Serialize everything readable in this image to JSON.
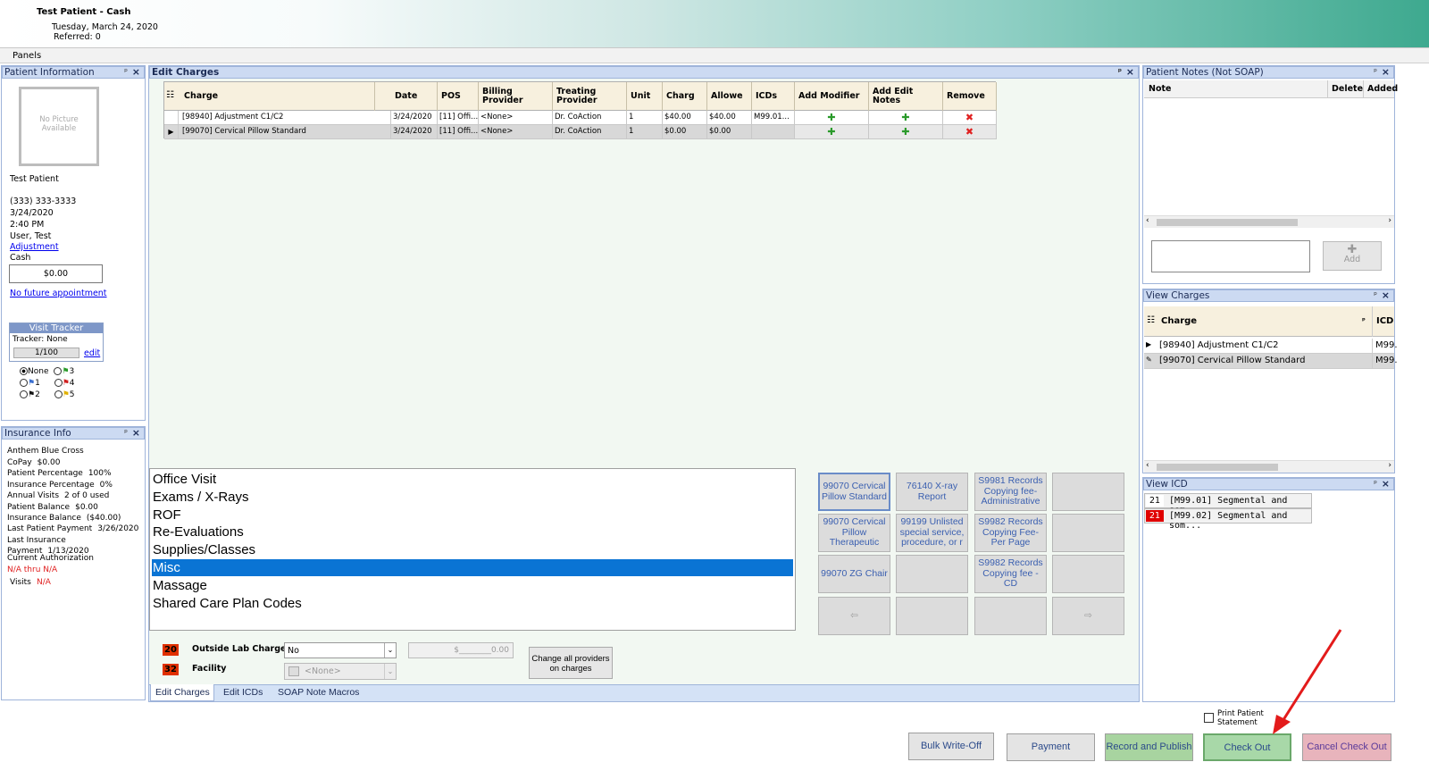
{
  "header": {
    "patient_title": "Test Patient - Cash",
    "date": "Tuesday, March 24, 2020",
    "referred": "Referred: 0"
  },
  "panels_label": "Panels",
  "patient_info": {
    "title": "Patient Information",
    "no_picture": "No Picture Available",
    "name": "Test Patient",
    "phone": "(333) 333-3333",
    "date": "3/24/2020",
    "time": "2:40 PM",
    "user": "User, Test",
    "adjustment_link": "Adjustment",
    "payer": "Cash",
    "balance": "$0.00",
    "future_appt": "No future appointment",
    "visit_tracker": {
      "title": "Visit Tracker",
      "tracker": "Tracker: None",
      "count": "1/100",
      "edit": "edit"
    },
    "flags": [
      "None",
      "1",
      "2",
      "3",
      "4",
      "5"
    ]
  },
  "insurance": {
    "title": "Insurance Info",
    "carrier": "Anthem Blue Cross",
    "rows": [
      {
        "k": "CoPay",
        "v": "$0.00"
      },
      {
        "k": "Patient Percentage",
        "v": "100%"
      },
      {
        "k": "Insurance Percentage",
        "v": "0%"
      },
      {
        "k": "Annual Visits",
        "v": "2 of 0 used"
      },
      {
        "k": "Patient Balance",
        "v": "$0.00"
      },
      {
        "k": "Insurance Balance",
        "v": "($40.00)"
      },
      {
        "k": "Last Patient Payment",
        "v": "3/26/2020"
      },
      {
        "k": "Last Insurance Payment",
        "v": "1/13/2020"
      }
    ],
    "current_auth": "Current Authorization",
    "auth_range": "N/A thru N/A",
    "visits_label": "Visits",
    "visits_value": "N/A"
  },
  "edit_charges": {
    "title": "Edit Charges",
    "columns": [
      "Charge",
      "Date",
      "POS",
      "Billing Provider",
      "Treating Provider",
      "Unit",
      "Charg",
      "Allowe",
      "ICDs",
      "Add Modifier",
      "Add Edit Notes",
      "Remove"
    ],
    "rows": [
      {
        "charge": "[98940] Adjustment C1/C2",
        "date": "3/24/2020",
        "pos": "[11] Offi...",
        "billing": "<None>",
        "treating": "Dr. CoAction",
        "unit": "1",
        "charg": "$40.00",
        "allowed": "$40.00",
        "icds": "M99.01..."
      },
      {
        "charge": "[99070] Cervical Pillow Standard",
        "date": "3/24/2020",
        "pos": "[11] Offi...",
        "billing": "<None>",
        "treating": "Dr. CoAction",
        "unit": "1",
        "charg": "$0.00",
        "allowed": "$0.00",
        "icds": ""
      }
    ],
    "categories": [
      "Office Visit",
      "Exams / X-Rays",
      "ROF",
      "Re-Evaluations",
      "Supplies/Classes",
      "Misc",
      "Massage",
      "Shared Care Plan Codes"
    ],
    "selected_category": "Misc",
    "quick_buttons": [
      "99070 Cervical Pillow Standard",
      "76140 X-ray Report",
      "S9981 Records Copying fee-Administrative",
      "",
      "99070 Cervical Pillow Therapeutic",
      "99199 Unlisted special service, procedure, or r",
      "S9982 Records Copying Fee-Per Page",
      "",
      "99070 ZG Chair",
      "",
      "S9982 Records Copying fee - CD",
      ""
    ],
    "outside_lab": {
      "badge": "20",
      "label": "Outside Lab Charges",
      "value": "No",
      "amount": "$________0.00"
    },
    "facility": {
      "badge": "32",
      "label": "Facility",
      "value": "<None>"
    },
    "change_providers": "Change all providers on charges",
    "tabs": [
      "Edit Charges",
      "Edit ICDs",
      "SOAP Note Macros"
    ]
  },
  "patient_notes": {
    "title": "Patient Notes (Not SOAP)",
    "columns": [
      "Note",
      "Delete",
      "Added"
    ],
    "add": "Add"
  },
  "view_charges": {
    "title": "View Charges",
    "columns": [
      "Charge",
      "ICD"
    ],
    "rows": [
      {
        "charge": "[98940] Adjustment C1/C2",
        "icd": "M99."
      },
      {
        "charge": "[99070] Cervical Pillow Standard",
        "icd": "M99."
      }
    ]
  },
  "view_icd": {
    "title": "View ICD",
    "rows": [
      {
        "num": "21",
        "text": "[M99.01] Segmental and som..."
      },
      {
        "num": "21",
        "text": "[M99.02] Segmental and som..."
      }
    ]
  },
  "bottom": {
    "print_statement": "Print Patient Statement",
    "bulk_writeoff": "Bulk Write-Off",
    "payment": "Payment",
    "record_publish": "Record and Publish",
    "check_out": "Check Out",
    "cancel_check_out": "Cancel Check Out"
  },
  "colors": {
    "accent": "#0a74d4",
    "panel_title": "#ccdaf2",
    "check_out": "#a8d8a8",
    "cancel": "#e8b4bc",
    "arrow": "#e31b1b"
  }
}
